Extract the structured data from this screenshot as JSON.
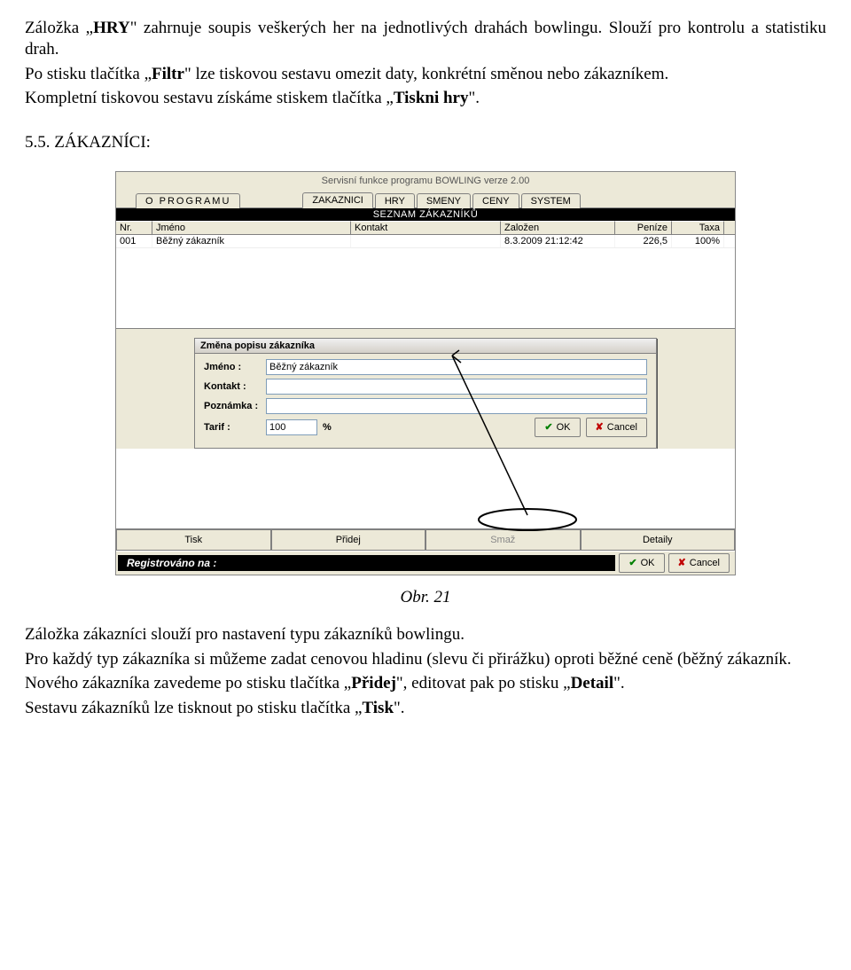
{
  "doc": {
    "p1_a": "Záložka „",
    "p1_b": "HRY",
    "p1_c": "\" zahrnuje soupis veškerých her na jednotlivých drahách bowlingu. Slouží pro kontrolu a statistiku drah.",
    "p2_a": "Po stisku tlačítka „",
    "p2_b": "Filtr",
    "p2_c": "\" lze tiskovou sestavu omezit daty, konkrétní směnou nebo zákazníkem.",
    "p3_a": "Kompletní tiskovou sestavu získáme stiskem tlačítka „",
    "p3_b": "Tiskni hry",
    "p3_c": "\".",
    "section": "5.5. ZÁKAZNÍCI:",
    "caption": "Obr. 21",
    "p4": "Záložka zákazníci slouží pro nastavení typu zákazníků bowlingu.",
    "p5": "Pro každý typ zákazníka si můžeme zadat cenovou hladinu (slevu či přirážku) oproti běžné ceně (běžný zákazník.",
    "p6_a": "Nového zákazníka zavedeme po stisku tlačítka „",
    "p6_b": "Přidej",
    "p6_c": "\", editovat pak po stisku „",
    "p6_d": "Detail",
    "p6_e": "\".",
    "p7_a": "Sestavu zákazníků lze tisknout po stisku tlačítka „",
    "p7_b": "Tisk",
    "p7_c": "\"."
  },
  "app": {
    "title": "Servisní funkce programu BOWLING verze 2.00",
    "tabs": {
      "programu": "O   PROGRAMU",
      "zakaznici": "ZAKAZNICI",
      "hry": "HRY",
      "smeny": "SMENY",
      "ceny": "CENY",
      "system": "SYSTEM"
    },
    "list_title": "SEZNAM ZÁKAZNÍKŮ",
    "columns": {
      "nr": "Nr.",
      "jmeno": "Jméno",
      "kontakt": "Kontakt",
      "zalozen": "Založen",
      "penize": "Peníze",
      "taxa": "Taxa"
    },
    "row1": {
      "nr": "001",
      "jmeno": "Běžný zákazník",
      "kontakt": "",
      "zalozen": "8.3.2009 21:12:42",
      "penize": "226,5",
      "taxa": "100%"
    },
    "bottom_buttons": {
      "tisk": "Tisk",
      "pridej": "Přidej",
      "smaz": "Smaž",
      "detaily": "Detaily"
    },
    "footer_label": "Registrováno na :",
    "btn_ok": "OK",
    "btn_cancel": "Cancel"
  },
  "dialog": {
    "title": "Změna popisu zákazníka",
    "labels": {
      "jmeno": "Jméno :",
      "kontakt": "Kontakt :",
      "poznamka": "Poznámka :",
      "tarif": "Tarif :",
      "percent": "%"
    },
    "values": {
      "jmeno": "Běžný zákazník",
      "kontakt": "",
      "poznamka": "",
      "tarif": "100"
    },
    "btn_ok": "OK",
    "btn_cancel": "Cancel"
  }
}
